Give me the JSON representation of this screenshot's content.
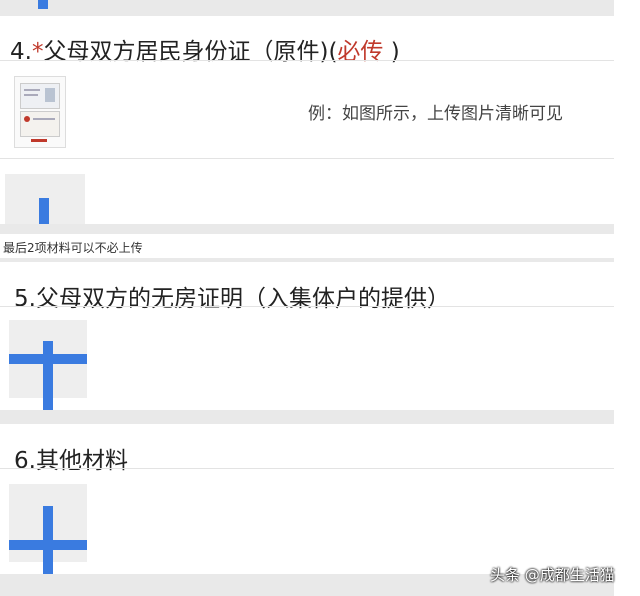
{
  "sections": {
    "s4": {
      "number": "4.",
      "required_mark": "*",
      "title": "父母双方居民身份证（原件)",
      "paren_open": "(",
      "required_text": "必传",
      "paren_close": " )",
      "example_text": "例：如图所示，上传图片清晰可见"
    },
    "note": "最后2项材料可以不必上传",
    "s5": {
      "title": "5.父母双方的无房证明（入集体户的提供）"
    },
    "s6": {
      "title": "6.其他材料"
    }
  },
  "watermark": "头条 @成都生活猫",
  "colors": {
    "accent": "#3a7be0",
    "required": "#c0392b"
  }
}
